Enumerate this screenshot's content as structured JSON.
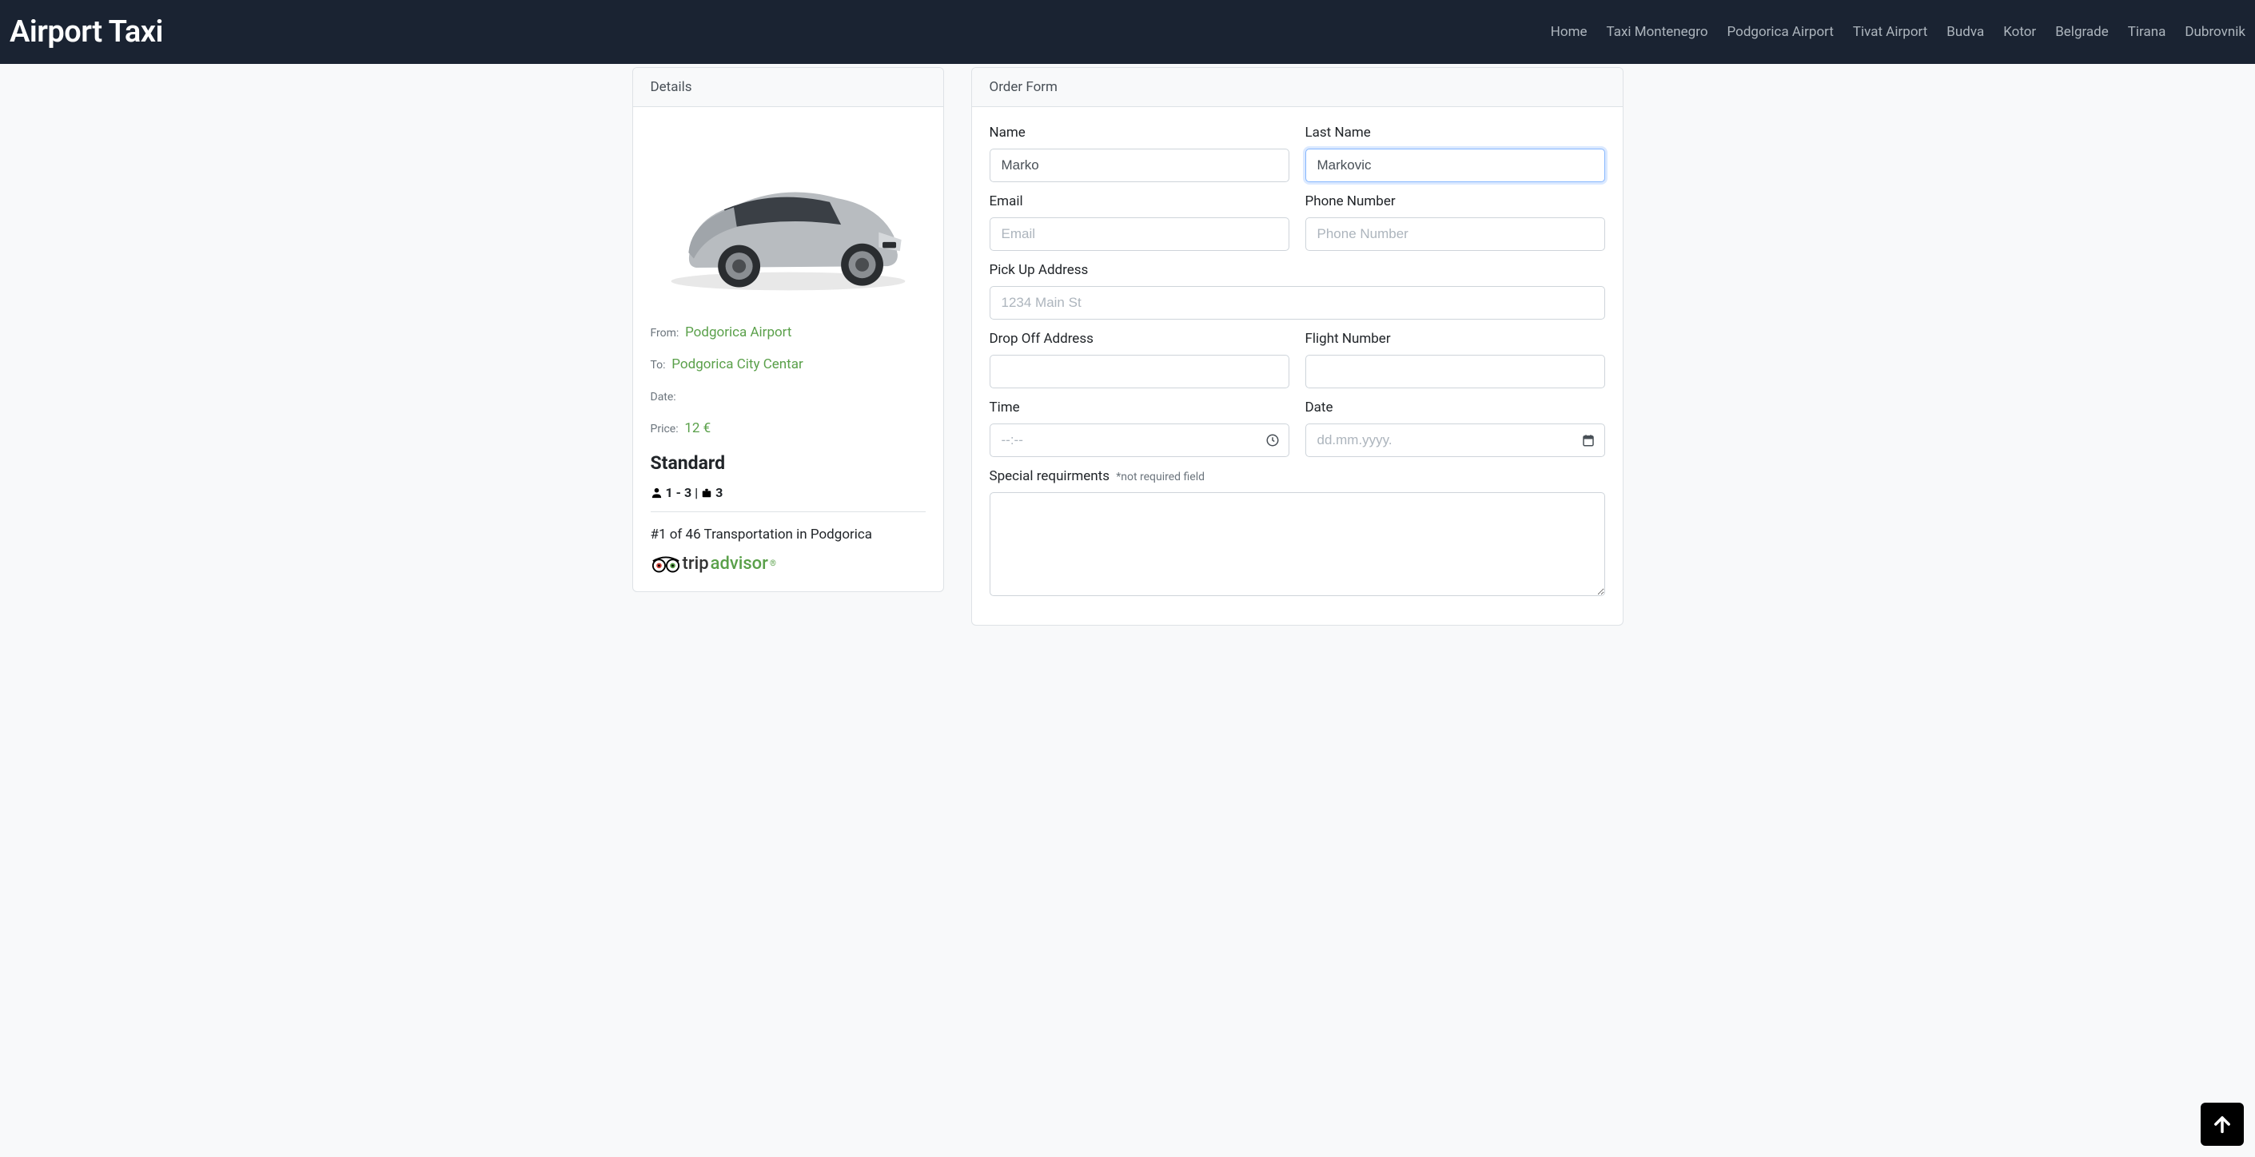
{
  "brand": "Airport Taxi",
  "nav": [
    "Home",
    "Taxi Montenegro",
    "Podgorica Airport",
    "Tivat Airport",
    "Budva",
    "Kotor",
    "Belgrade",
    "Tirana",
    "Dubrovnik"
  ],
  "details": {
    "header": "Details",
    "from_label": "From:",
    "from_value": "Podgorica Airport",
    "to_label": "To:",
    "to_value": "Podgorica City Centar",
    "date_label": "Date:",
    "date_value": "",
    "price_label": "Price:",
    "price_value": "12 €",
    "class_name": "Standard",
    "passengers": "1 - 3",
    "separator": " | ",
    "luggage": "3",
    "rank": "#1 of 46 Transportation in Podgorica",
    "tripadvisor_trip": "trip",
    "tripadvisor_advisor": "advisor"
  },
  "form": {
    "header": "Order Form",
    "name_label": "Name",
    "name_value": "Marko",
    "lastname_label": "Last Name",
    "lastname_value": "Markovic",
    "email_label": "Email",
    "email_placeholder": "Email",
    "phone_label": "Phone Number",
    "phone_placeholder": "Phone Number",
    "pickup_label": "Pick Up Address",
    "pickup_placeholder": "1234 Main St",
    "dropoff_label": "Drop Off Address",
    "flight_label": "Flight Number",
    "time_label": "Time",
    "time_placeholder": "--:--",
    "date_label": "Date",
    "date_placeholder": "dd.mm.yyyy.",
    "special_label": "Special requirments",
    "special_hint": "*not required field"
  }
}
